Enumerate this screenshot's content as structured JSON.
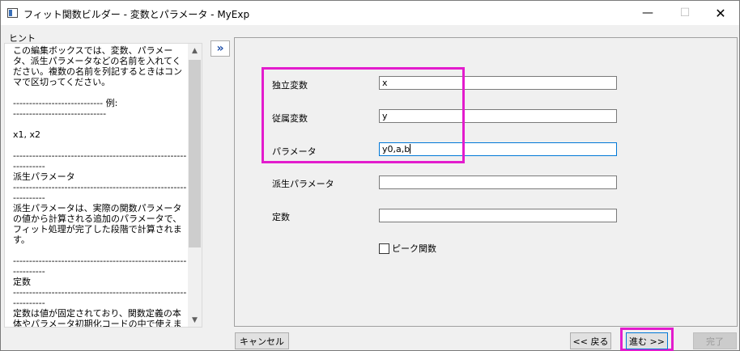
{
  "window": {
    "title": "フィット関数ビルダー - 変数とパラメータ - MyExp",
    "minimize_glyph": "—",
    "maximize_glyph": "☐",
    "close_glyph": "✕"
  },
  "hint": {
    "label": "ヒント",
    "text": "この編集ボックスでは、変数、パラメータ、派生パラメータなどの名前を入れてください。複数の名前を列記するときはコンマで区切ってください。\n\n---------------------------- 例:\n-----------------------------\n\nx1, x2\n\n----------------------------------------------------------------\n派生パラメータ\n----------------------------------------------------------------\n派生パラメータは、実際の関数パラメータの値から計算される追加のパラメータで、フィット処理が完了した段階で計算されます。\n\n----------------------------------------------------------------\n定数\n----------------------------------------------------------------\n定数は値が固定されており、関数定義の本体やパラメータ初期化コードの中で使えます。",
    "scroll_up_glyph": "▲",
    "scroll_down_glyph": "▼"
  },
  "expand_button": {
    "glyph": "»"
  },
  "form": {
    "independent": {
      "label": "独立変数",
      "value": "x"
    },
    "dependent": {
      "label": "従属変数",
      "value": "y"
    },
    "parameters": {
      "label": "パラメータ",
      "value": "y0,a,b"
    },
    "derived": {
      "label": "派生パラメータ",
      "value": ""
    },
    "constants": {
      "label": "定数",
      "value": ""
    },
    "peak_function": {
      "label": "ピーク関数",
      "checked": false
    }
  },
  "buttons": {
    "cancel": "キャンセル",
    "back": "<< 戻る",
    "next": "進む >>",
    "finish": "完了"
  },
  "colors": {
    "highlight": "#e31ccd",
    "focus": "#0078d7"
  }
}
